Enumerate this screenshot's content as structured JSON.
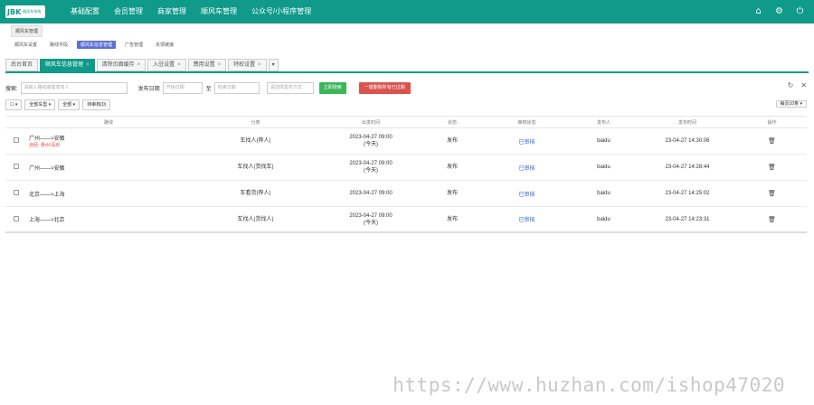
{
  "topnav": {
    "logo_mark": "JBK",
    "logo_name": "顺风车系统",
    "items": [
      "基础配置",
      "会员管理",
      "商家管理",
      "顺风车管理",
      "公众号/小程序管理"
    ],
    "icons": [
      "home-icon",
      "gear-icon",
      "power-icon"
    ]
  },
  "subheader": {
    "title": "顺风车管理"
  },
  "subnav": {
    "items": [
      "顺风车设置",
      "路线字段",
      "顺风车信息管理",
      "广告管理",
      "反馈链接"
    ],
    "active_index": 2
  },
  "tabs": [
    {
      "label": "后台首页",
      "closable": false
    },
    {
      "label": "顺风车信息管理",
      "closable": true,
      "active": true
    },
    {
      "label": "清除页面缓存",
      "closable": true
    },
    {
      "label": "入驻设置",
      "closable": true
    },
    {
      "label": "费用设置",
      "closable": true
    },
    {
      "label": "特权设置",
      "closable": true
    }
  ],
  "search": {
    "label": "搜索:",
    "keyword_placeholder": "请输入路线或者发布人",
    "date_label": "发布日期",
    "start_placeholder": "开始日期",
    "to_label": "至",
    "end_placeholder": "结束日期",
    "type_placeholder": "请选择发布方式",
    "search_button": "立即搜索",
    "delete_button": "一键删除所有已过期"
  },
  "toolbar": {
    "select_label": "☐ ▾",
    "all_routes": "全部车型 ▾",
    "all_status": "全部 ▾",
    "batch_review": "待审核(0)",
    "per_page": "每页10条 ▾"
  },
  "table": {
    "headers": [
      "路线",
      "分类",
      "出发时间",
      "状态",
      "审核状态",
      "发布人",
      "发布时间",
      "操作"
    ],
    "rows": [
      {
        "route": "广州——>安徽",
        "route_note": "途经: 惠州/深圳",
        "category": "车找人(荐人)",
        "time": "2023-04-27 09:00",
        "time_note": "(今天)",
        "status": "发布",
        "review": "已审核",
        "publisher": "baidu",
        "pub_time": "23-04-27 14:30:06"
      },
      {
        "route": "广州——>安徽",
        "route_note": "",
        "category": "车找人(货找车)",
        "time": "2023-04-27 09:00",
        "time_note": "(今天)",
        "status": "发布",
        "review": "已审核",
        "publisher": "baidu",
        "pub_time": "23-04-27 14:28:44"
      },
      {
        "route": "北京——>上海",
        "route_note": "",
        "category": "车看货(荐人)",
        "time": "2023-04-27 09:00",
        "time_note": "",
        "status": "发布",
        "review": "已审核",
        "publisher": "baidu",
        "pub_time": "23-04-27 14:25:02"
      },
      {
        "route": "上海——>北京",
        "route_note": "",
        "category": "车找人(货找人)",
        "time": "2023-04-27 09:00",
        "time_note": "(今天)",
        "status": "发布",
        "review": "已审核",
        "publisher": "baidu",
        "pub_time": "23-04-27 14:23:31"
      }
    ]
  },
  "watermark": "https://www.huzhan.com/ishop47020"
}
